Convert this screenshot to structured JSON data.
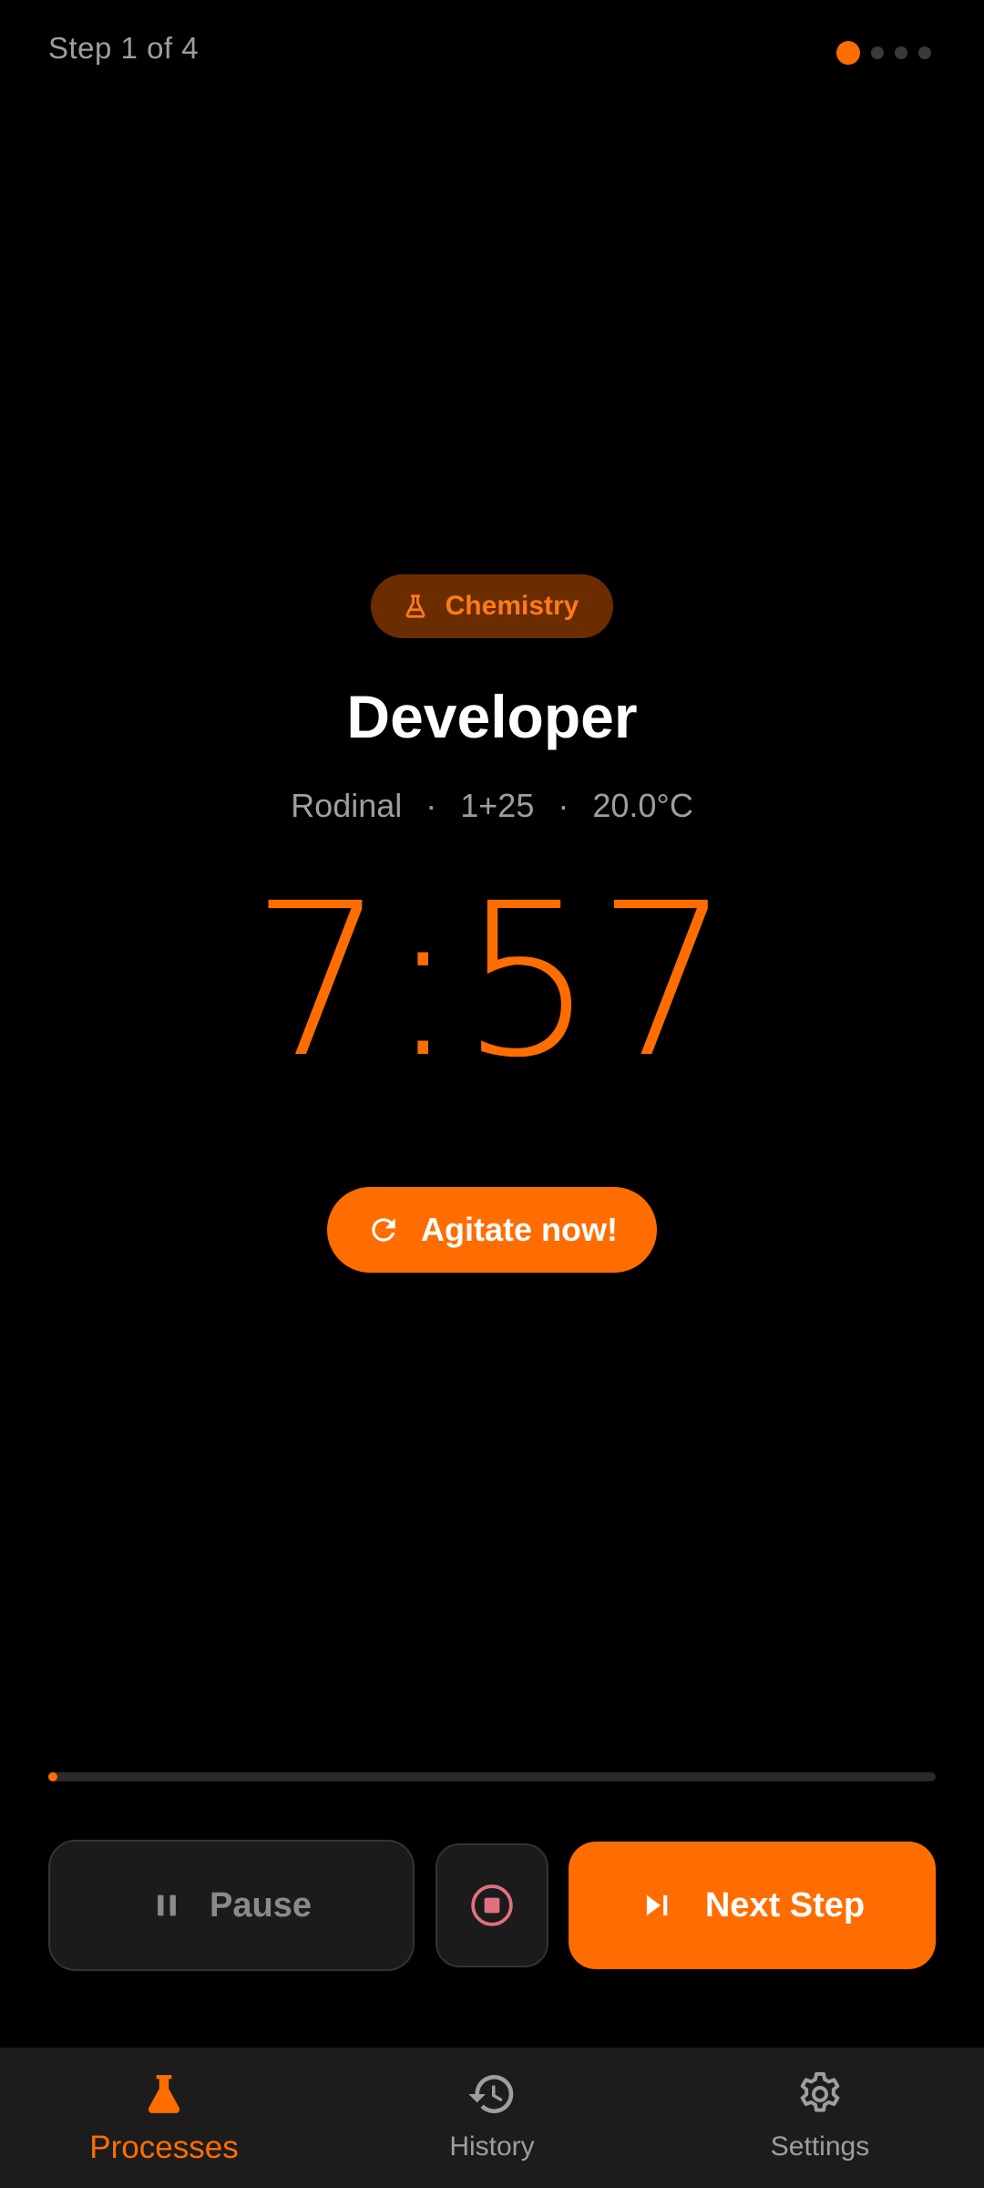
{
  "header": {
    "step_label": "Step 1 of 4",
    "total_steps": 4,
    "current_step": 1
  },
  "step": {
    "chip": {
      "icon": "flask-icon",
      "label": "Chemistry"
    },
    "title": "Developer",
    "details": {
      "chemical": "Rodinal",
      "separator": "·",
      "dilution": "1+25",
      "temperature": "20.0°C"
    },
    "timer": "7:57"
  },
  "actions": {
    "agitate_label": "Agitate now!",
    "agitate_icon": "refresh-icon",
    "pause_label": "Pause",
    "pause_icon": "pause-icon",
    "stop_icon": "stop-circle-icon",
    "next_label": "Next Step",
    "next_icon": "skip-next-icon"
  },
  "progress": {
    "fraction": 0.01
  },
  "nav": {
    "items": [
      {
        "label": "Processes",
        "icon": "flask-icon",
        "active": true
      },
      {
        "label": "History",
        "icon": "history-icon",
        "active": false
      },
      {
        "label": "Settings",
        "icon": "gear-icon",
        "active": false
      }
    ]
  },
  "colors": {
    "accent": "#ff6d00",
    "chip_bg": "#6b2c00",
    "background": "#000000",
    "surface": "#1b1b1b",
    "nav_bg": "#1c1c1c",
    "muted_text": "#9e9e9e",
    "stop_icon": "#e07080"
  }
}
